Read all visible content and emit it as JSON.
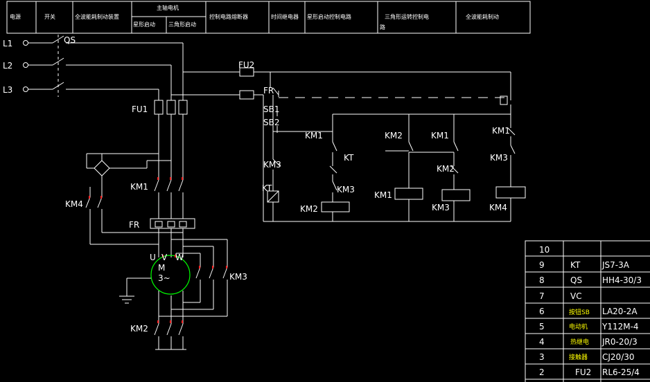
{
  "header": {
    "cells": [
      "电源",
      "开关",
      "全波能耗制动装置",
      "主轴电机",
      "星形启动",
      "三角形启动",
      "控制电路熔断器",
      "时间继电器",
      "星形启动控制电路",
      "三角形运转控制电",
      "路",
      "全波能耗制动"
    ]
  },
  "labels": {
    "l1": "L1",
    "l2": "L2",
    "l3": "L3",
    "qs": "QS",
    "fu1": "FU1",
    "fu2": "FU2",
    "fr": "FR",
    "fr2": "FR",
    "sb1": "SB1",
    "sb2": "SB2",
    "km1a": "KM1",
    "km1b": "KM1",
    "km1c": "KM1",
    "km1coil": "KM1",
    "km1d": "KM1",
    "km2a": "KM2",
    "km2coil": "KM2",
    "km2b": "KM2",
    "km2c": "KM2",
    "km3a": "KM3",
    "km3b": "KM3",
    "km3coil": "KM3",
    "km3c": "KM3",
    "km4a": "KM4",
    "km4coil": "KM4",
    "kt": "KT",
    "kt2": "KT",
    "ktcoil": "KT",
    "motor_m": "M",
    "motor_3": "3~",
    "u": "U",
    "v": "V",
    "w": "W"
  },
  "parts_table": {
    "rows": [
      {
        "no": "10",
        "code": "",
        "model": ""
      },
      {
        "no": "9",
        "code": "KT",
        "model": "JS7-3A"
      },
      {
        "no": "8",
        "code": "QS",
        "model": "HH4-30/3"
      },
      {
        "no": "7",
        "code": "VC",
        "model": ""
      },
      {
        "no": "6",
        "code": "按钮SB",
        "model": "LA20-2A"
      },
      {
        "no": "5",
        "code": "电动机",
        "model": "Y112M-4"
      },
      {
        "no": "4",
        "code": "热继电",
        "model": "JR0-20/3"
      },
      {
        "no": "3",
        "code": "接触器",
        "model": "CJ20/30"
      },
      {
        "no": "2",
        "code": "FU2",
        "model": "RL6-25/4"
      }
    ]
  }
}
